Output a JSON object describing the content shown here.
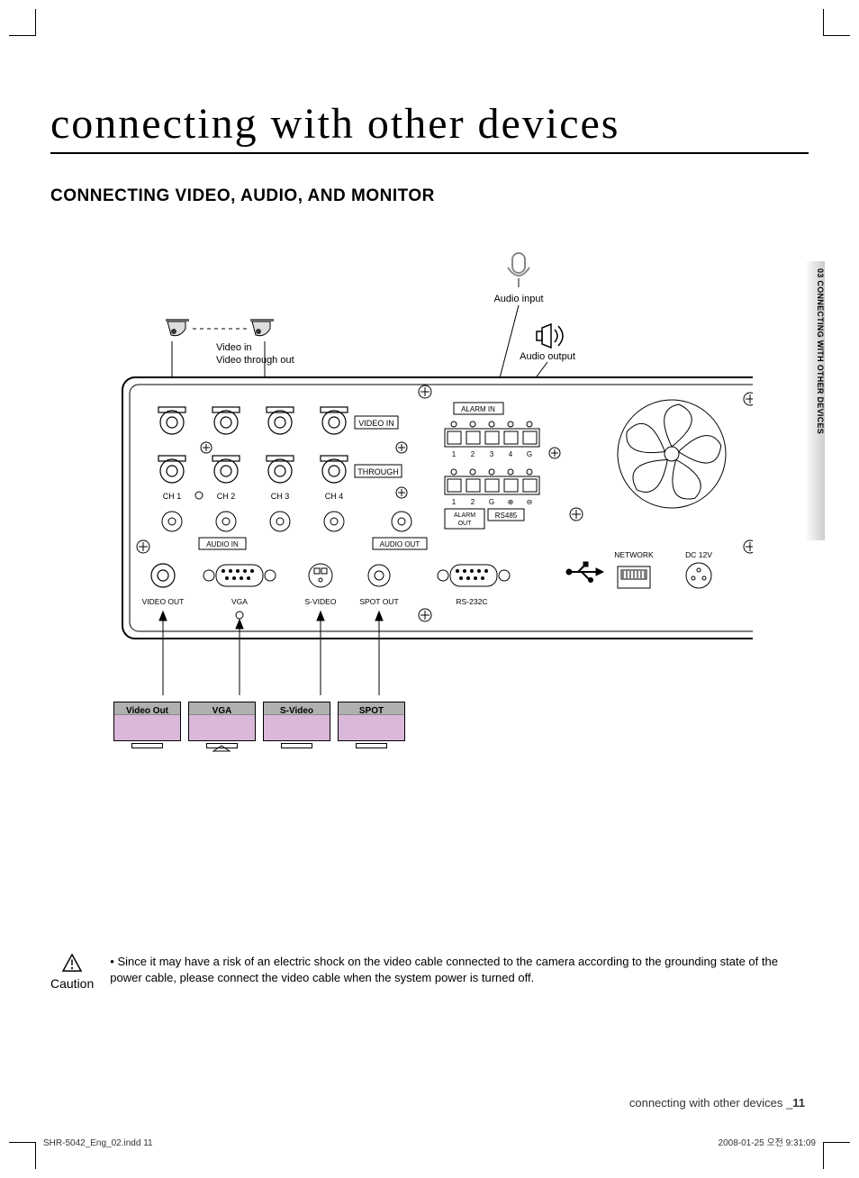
{
  "page": {
    "title": "connecting with other devices",
    "subtitle": "CONNECTING VIDEO, AUDIO, AND MONITOR",
    "side_tab": "03 CONNECTING WITH OTHER DEVICES",
    "footer_text": "connecting with other devices _",
    "footer_page": "11",
    "indd": "SHR-5042_Eng_02.indd   11",
    "date": "2008-01-25   오전 9:31:09"
  },
  "diagram": {
    "audio_input": "Audio input",
    "audio_output": "Audio output",
    "video_in": "Video in",
    "video_through": "Video through out",
    "panel": {
      "video_in": "VIDEO IN",
      "through": "THROUGH",
      "ch1": "CH 1",
      "ch2": "CH 2",
      "ch3": "CH 3",
      "ch4": "CH 4",
      "audio_in": "AUDIO IN",
      "audio_out": "AUDIO OUT",
      "alarm_in": "ALARM IN",
      "alarm_out": "ALARM\nOUT",
      "rs485": "RS485",
      "video_out": "VIDEO OUT",
      "vga": "VGA",
      "svideo": "S-VIDEO",
      "spot_out": "SPOT OUT",
      "rs232c": "RS-232C",
      "network": "NETWORK",
      "dc12v": "DC 12V",
      "terminals": {
        "row1": [
          "1",
          "2",
          "3",
          "4",
          "G"
        ],
        "row2": [
          "1",
          "2",
          "G",
          "⊕",
          "⊖"
        ]
      }
    },
    "monitors": [
      "Video Out",
      "VGA",
      "S-Video",
      "SPOT"
    ]
  },
  "caution": {
    "label": "Caution",
    "bullet": "•",
    "text": "Since it may have a risk of an electric shock on the video cable connected to the camera according to the grounding state of the power cable, please connect the video cable when the system power is turned off."
  }
}
